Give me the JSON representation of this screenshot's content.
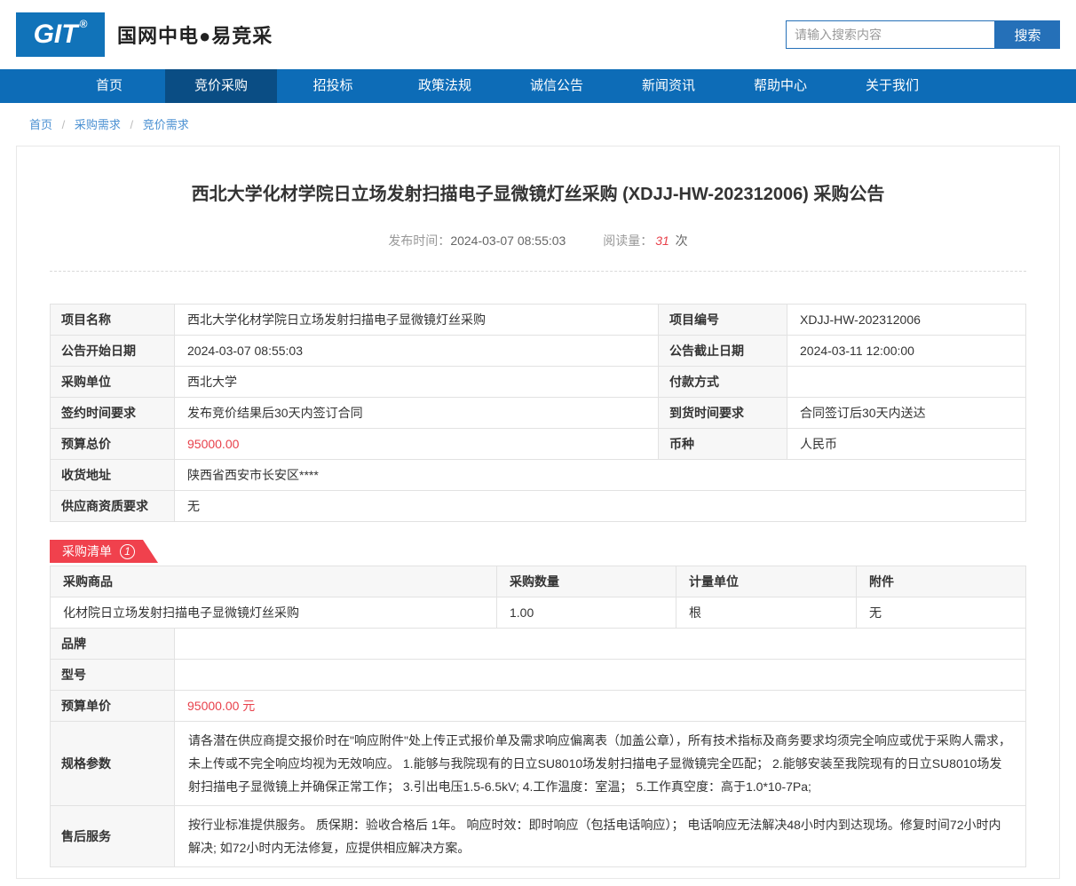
{
  "header": {
    "logo_text": "GIT",
    "logo_reg": "®",
    "site_name": "国网中电●易竞采",
    "search": {
      "placeholder": "请输入搜索内容",
      "button_label": "搜索"
    }
  },
  "nav": {
    "items": [
      {
        "label": "首页",
        "active": false
      },
      {
        "label": "竞价采购",
        "active": true
      },
      {
        "label": "招投标",
        "active": false
      },
      {
        "label": "政策法规",
        "active": false
      },
      {
        "label": "诚信公告",
        "active": false
      },
      {
        "label": "新闻资讯",
        "active": false
      },
      {
        "label": "帮助中心",
        "active": false
      },
      {
        "label": "关于我们",
        "active": false
      }
    ]
  },
  "breadcrumb": {
    "separator": "/",
    "items": [
      "首页",
      "采购需求",
      "竞价需求"
    ]
  },
  "announcement": {
    "title": "西北大学化材学院日立场发射扫描电子显微镜灯丝采购 (XDJJ-HW-202312006) 采购公告",
    "publish_time_label": "发布时间：",
    "publish_time": "2024-03-07 08:55:03",
    "read_count_label": "阅读量：",
    "read_count": "31",
    "read_count_unit": "次"
  },
  "info_table": {
    "rows": [
      {
        "label1": "项目名称",
        "value1": "西北大学化材学院日立场发射扫描电子显微镜灯丝采购",
        "label2": "项目编号",
        "value2": "XDJJ-HW-202312006"
      },
      {
        "label1": "公告开始日期",
        "value1": "2024-03-07 08:55:03",
        "label2": "公告截止日期",
        "value2": "2024-03-11 12:00:00"
      },
      {
        "label1": "采购单位",
        "value1": "西北大学",
        "label2": "付款方式",
        "value2": ""
      },
      {
        "label1": "签约时间要求",
        "value1": "发布竞价结果后30天内签订合同",
        "label2": "到货时间要求",
        "value2": "合同签订后30天内送达"
      },
      {
        "label1": "预算总价",
        "value1": "95000.00",
        "label2": "币种",
        "value2": "人民币"
      },
      {
        "label1": "收货地址",
        "value1": "陕西省西安市长安区****"
      },
      {
        "label1": "供应商资质要求",
        "value1": "无"
      }
    ]
  },
  "purchase_list": {
    "tab_label": "采购清单",
    "tab_count": "1",
    "headers": [
      "采购商品",
      "采购数量",
      "计量单位",
      "附件"
    ],
    "product_row": {
      "name": "化材院日立场发射扫描电子显微镜灯丝采购",
      "quantity": "1.00",
      "unit": "根",
      "attachment": "无"
    },
    "details": {
      "brand_label": "品牌",
      "brand_value": "",
      "model_label": "型号",
      "model_value": "",
      "unit_price_label": "预算单价",
      "unit_price_value": "95000.00 元",
      "spec_label": "规格参数",
      "spec_value": "请各潜在供应商提交报价时在\"响应附件\"处上传正式报价单及需求响应偏离表（加盖公章），所有技术指标及商务要求均须完全响应或优于采购人需求，未上传或不完全响应均视为无效响应。 1.能够与我院现有的日立SU8010场发射扫描电子显微镜完全匹配； 2.能够安装至我院现有的日立SU8010场发射扫描电子显微镜上并确保正常工作； 3.引出电压1.5-6.5kV; 4.工作温度：室温； 5.工作真空度：高于1.0*10-7Pa;",
      "service_label": "售后服务",
      "service_value": "按行业标准提供服务。 质保期：验收合格后 1年。 响应时效：即时响应（包括电话响应）； 电话响应无法解决48小时内到达现场。修复时间72小时内解决; 如72小时内无法修复，应提供相应解决方案。"
    }
  },
  "colors": {
    "nav_blue": "#0d6cb7",
    "nav_active_blue": "#0a4d84",
    "logo_blue": "#1173b9",
    "search_blue": "#2570b8",
    "breadcrumb_link_blue": "#4a90d2",
    "tab_red": "#f0414d",
    "price_red": "#e8414b",
    "label_cell_bg": "#f7f7f7",
    "table_border": "#e2e2e2"
  }
}
